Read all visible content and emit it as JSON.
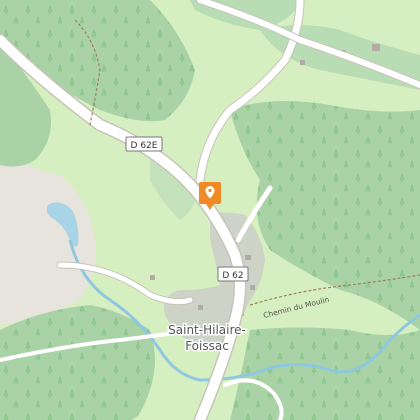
{
  "map": {
    "places": [
      {
        "line1": "Saint-Hilaire-",
        "line2": "Foissac"
      }
    ],
    "road_shields": [
      {
        "text": "D 62E"
      },
      {
        "text": "D 62"
      }
    ],
    "street_labels": [
      {
        "text": "Chemin du Moulin"
      }
    ],
    "marker": {
      "icon": "location-pin-icon",
      "color": "#f08a24"
    },
    "colors": {
      "forest": "#a9d3a6",
      "meadow": "#d6efc0",
      "bare": "#e7e4de",
      "water": "#a9d3e6",
      "river": "#8ec8e0",
      "road": "#ffffff",
      "builtup": "#c9c9c9"
    }
  }
}
